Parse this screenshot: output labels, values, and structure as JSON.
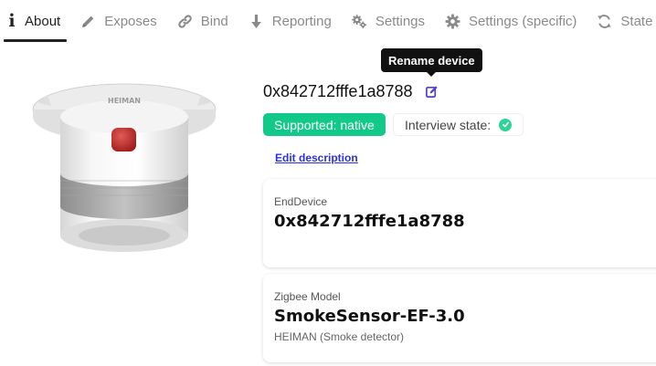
{
  "tabs": [
    {
      "label": "About",
      "icon": "info-icon",
      "active": true
    },
    {
      "label": "Exposes",
      "icon": "pencil-icon",
      "active": false
    },
    {
      "label": "Bind",
      "icon": "link-icon",
      "active": false
    },
    {
      "label": "Reporting",
      "icon": "arrow-down-icon",
      "active": false
    },
    {
      "label": "Settings",
      "icon": "cogs-icon",
      "active": false
    },
    {
      "label": "Settings (specific)",
      "icon": "gear-icon",
      "active": false
    },
    {
      "label": "State",
      "icon": "sync-icon",
      "active": false
    }
  ],
  "device": {
    "ieee_address": "0x842712fffe1a8788",
    "image_brand": "HEIMAN",
    "rename_tooltip": "Rename device",
    "supported_badge": "Supported: native",
    "interview_label": "Interview state:",
    "edit_description": "Edit description"
  },
  "cards": {
    "type": {
      "label": "EndDevice",
      "value": "0x842712fffe1a8788"
    },
    "model": {
      "label": "Zigbee Model",
      "value": "SmokeSensor-EF-3.0",
      "sub": "HEIMAN (Smoke detector)"
    }
  },
  "colors": {
    "supported_green": "#12c98a",
    "check_green": "#2fd39a",
    "link_blue": "#2b32d8",
    "rename_icon": "#4a3fe0"
  }
}
